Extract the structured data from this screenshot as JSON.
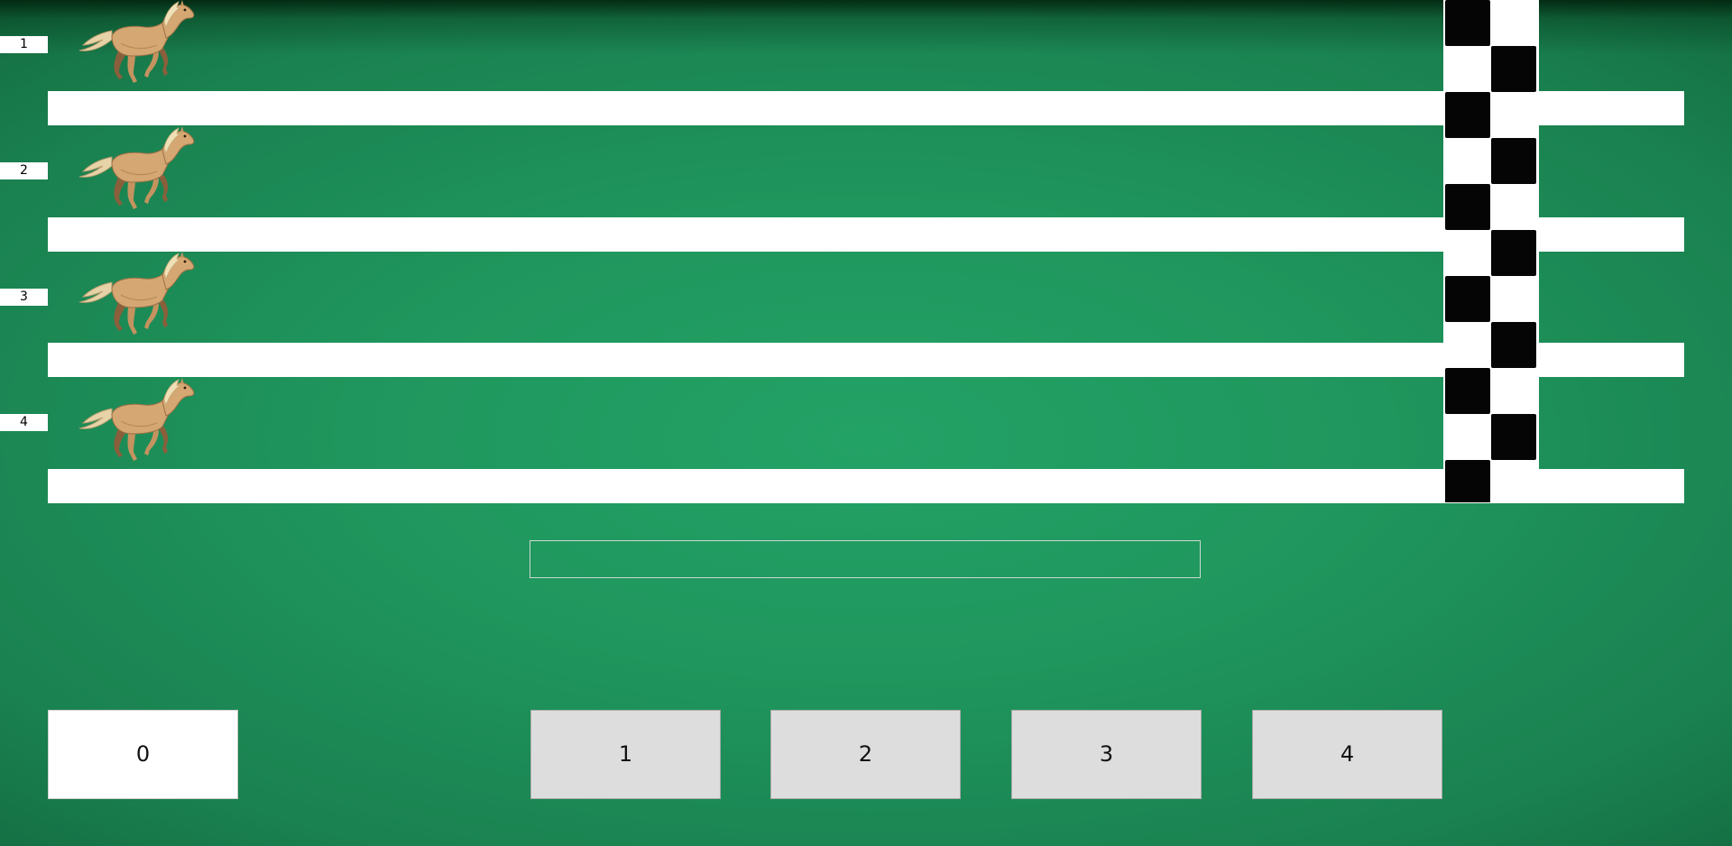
{
  "lanes": [
    {
      "number": "1"
    },
    {
      "number": "2"
    },
    {
      "number": "3"
    },
    {
      "number": "4"
    }
  ],
  "horse_icon": "galloping-horse",
  "message": "",
  "buttons": {
    "zero": "0",
    "one": "1",
    "two": "2",
    "three": "3",
    "four": "4"
  },
  "colors": {
    "track_green": "#1f965d",
    "rail_white": "#ffffff",
    "button_gray": "#dddddd",
    "finish_black": "#050505"
  }
}
